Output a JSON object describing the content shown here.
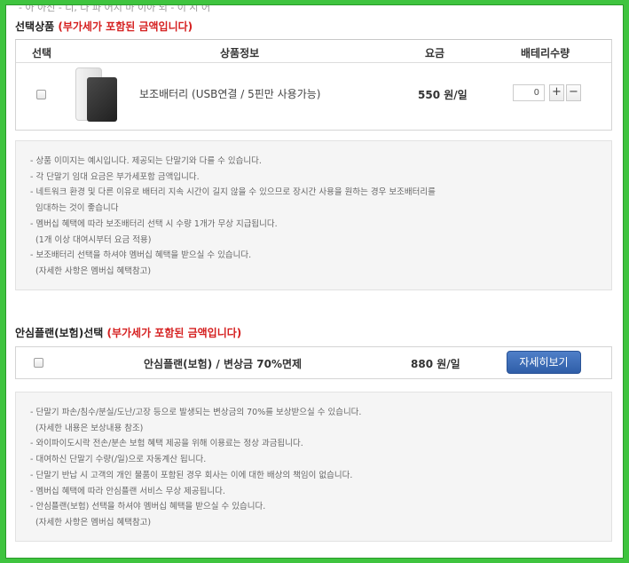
{
  "top_clipped_text": "- 아 아신 - 디, 다 파 어지 마 이아 되 - 이 시 어",
  "product_section": {
    "title": "선택상품",
    "note": "(부가세가 포함된 금액입니다)",
    "headers": {
      "select": "선택",
      "info": "상품정보",
      "price": "요금",
      "qty": "배테리수량"
    },
    "item": {
      "name": "보조배터리 (USB연결 / 5핀만 사용가능)",
      "price": "550 원/일",
      "qty_value": "0",
      "plus_label": "+",
      "minus_label": "−"
    },
    "notes": [
      "- 상품 이미지는 예시입니다. 제공되는 단말기와 다를 수 있습니다.",
      "- 각 단말기 임대 요금은 부가세포함 금액입니다.",
      "- 네트워크 환경 및 다른 이유로 배터리 지속 시간이 길지 않을 수 있으므로 장시간 사용을 원하는 경우 보조배터리를",
      "  임대하는 것이 좋습니다",
      "- 멤버십 혜택에 따라 보조배터리 선택 시 수량 1개가 무상 지급됩니다.",
      "  (1개 이상 대여시부터 요금 적용)",
      "- 보조배터리 선택을 하셔야 멤버십 혜택을 받으실 수 있습니다.",
      "  (자세한 사항은 멤버십 혜택참고)"
    ]
  },
  "plan_section": {
    "title": "안심플랜(보험)선택",
    "note": "(부가세가 포함된 금액입니다)",
    "plan": {
      "name": "안심플랜(보험) / 변상금 70%면제",
      "price": "880 원/일",
      "detail_button": "자세히보기"
    },
    "notes": [
      "- 단말기 파손/침수/분실/도난/고장 등으로 발생되는 변상금의 70%를 보상받으실 수 있습니다.",
      "  (자세한 내용은 보상내용 참조)",
      "- 와이파이도시락 전손/분손 보험 혜택 제공을 위해 이용료는 정상 과금됩니다.",
      "- 대여하신 단말기 수량(/일)으로 자동계산 됩니다.",
      "- 단말기 반납 시 고객의 개인 물품이 포함된 경우 회사는 이에 대한 배상의 책임이 없습니다.",
      "- 멤버십 혜택에 따라 안심플랜 서비스 무상 제공됩니다.",
      "- 안심플랜(보험) 선택을 하셔야 멤버십 혜택을 받으실 수 있습니다.",
      "  (자세한 사항은 멤버십 혜택참고)"
    ]
  }
}
